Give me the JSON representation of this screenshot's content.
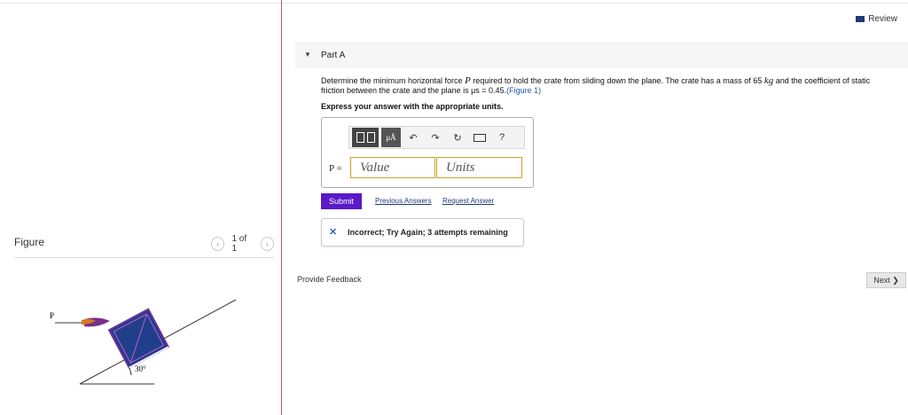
{
  "review": {
    "label": "Review",
    "icon": "book-icon"
  },
  "part": {
    "label": "Part A"
  },
  "question": {
    "text_1": "Determine the minimum horizontal force ",
    "var_p": "P",
    "text_2": " required to hold the crate from sliding down the plane. The crate has a mass of 65 ",
    "unit_kg": "kg",
    "text_3": " and the coefficient of static friction between the crate and the plane is ",
    "mu": "μs = 0.45",
    "text_4": ".",
    "figure_link": "(Figure 1)"
  },
  "instruction": "Express your answer with the appropriate units.",
  "toolbar": {
    "mu_label": "μÅ",
    "undo": "↶",
    "redo": "↷",
    "reset": "↻",
    "keyboard": "⌨",
    "help": "?"
  },
  "answer": {
    "var_label": "P =",
    "value_placeholder": "Value",
    "units_placeholder": "Units"
  },
  "buttons": {
    "submit": "Submit",
    "previous_answers": "Previous Answers",
    "request_answer": "Request Answer",
    "next": "Next ❯"
  },
  "feedback": {
    "icon": "✕",
    "text": "Incorrect; Try Again; 3 attempts remaining"
  },
  "provide_feedback": "Provide Feedback",
  "figure": {
    "title": "Figure",
    "pager": "1 of 1",
    "prev": "‹",
    "next": "›",
    "force_label": "P",
    "angle_label": "30°"
  },
  "colors": {
    "submit": "#5b19c8",
    "crate_fill": "#1f3f8a",
    "rope": "#7b2d8b",
    "divider": "#d9534f"
  }
}
